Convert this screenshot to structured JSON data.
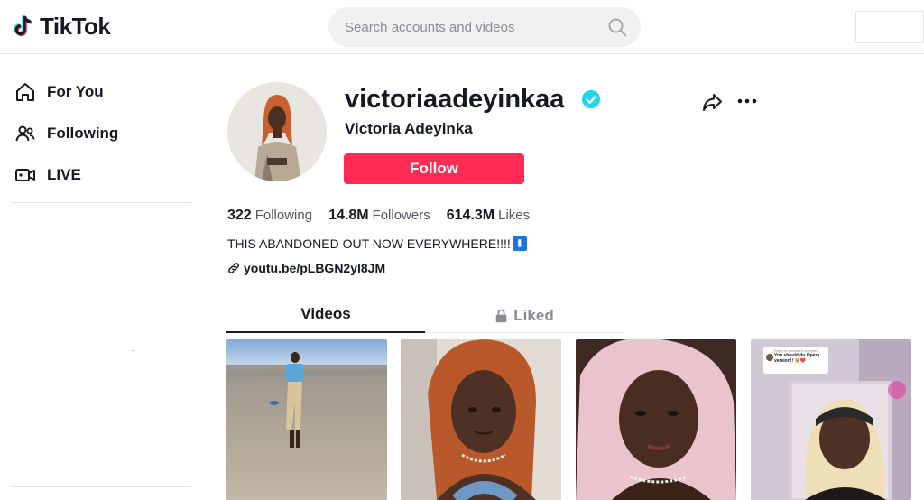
{
  "app": {
    "name": "TikTok"
  },
  "search": {
    "placeholder": "Search accounts and videos"
  },
  "sidebar": {
    "items": [
      {
        "label": "For You",
        "icon": "home-icon"
      },
      {
        "label": "Following",
        "icon": "users-icon"
      },
      {
        "label": "LIVE",
        "icon": "live-icon"
      }
    ]
  },
  "profile": {
    "username": "victoriaadeyinkaa",
    "display_name": "Victoria Adeyinka",
    "verified": true,
    "follow_label": "Follow",
    "stats": {
      "following": {
        "value": "322",
        "label": "Following"
      },
      "followers": {
        "value": "14.8M",
        "label": "Followers"
      },
      "likes": {
        "value": "614.3M",
        "label": "Likes"
      }
    },
    "bio": "THIS ABANDONED OUT NOW EVERYWHERE!!!!",
    "bio_emoji": "⬇",
    "link": "youtu.be/pLBGN2yl8JM"
  },
  "tabs": [
    {
      "label": "Videos",
      "active": true
    },
    {
      "label": "Liked",
      "active": false,
      "locked": true
    }
  ],
  "videos": [
    {
      "caption_lines": []
    },
    {
      "caption_lines": []
    },
    {
      "caption_lines": []
    },
    {
      "caption_lines": [
        "Reply to cocklad's comment",
        "You should do Opera version!! 🥹❤️"
      ]
    }
  ],
  "colors": {
    "accent": "#fe2c55",
    "verified": "#20d5ec",
    "text": "#161823",
    "muted": "#8a8b91"
  }
}
